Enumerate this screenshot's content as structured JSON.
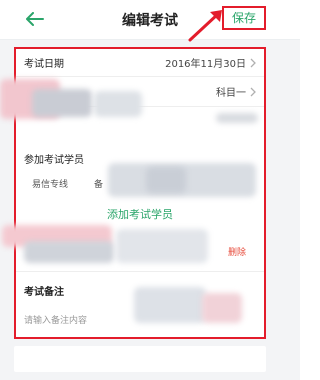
{
  "header": {
    "title": "编辑考试",
    "save_label": "保存"
  },
  "form": {
    "exam_date": {
      "label": "考试日期",
      "value": "2016年11月30日"
    },
    "subject": {
      "value": "科目一"
    },
    "participants": {
      "label": "参加考试学员",
      "chips": [
        "易信专线",
        "备"
      ],
      "add_label": "添加考试学员"
    },
    "student_row": {
      "delete_label": "删除"
    },
    "notes": {
      "label": "考试备注",
      "placeholder": "请输入备注内容"
    }
  },
  "colors": {
    "accent_green": "#2aa56a",
    "annotation_red": "#e31c2b",
    "delete_red": "#e74c3c"
  },
  "icons": {
    "back": "arrow-left-icon",
    "chevron": "chevron-right-icon"
  }
}
